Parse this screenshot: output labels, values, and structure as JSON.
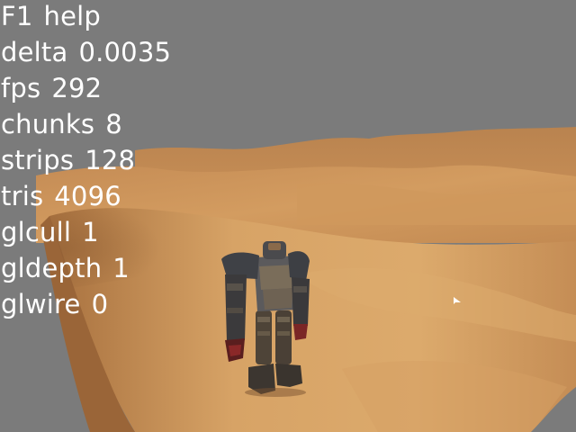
{
  "hud": {
    "lines": [
      {
        "key": "F1",
        "value": "help"
      },
      {
        "key": "delta",
        "value": "0.0035"
      },
      {
        "key": "fps",
        "value": "292"
      },
      {
        "key": "chunks",
        "value": "8"
      },
      {
        "key": "strips",
        "value": "128"
      },
      {
        "key": "tris",
        "value": "4096"
      },
      {
        "key": "glcull",
        "value": "1"
      },
      {
        "key": "gldepth",
        "value": "1"
      },
      {
        "key": "glwire",
        "value": "0"
      }
    ]
  },
  "scene": {
    "sky_color": "#7b7b7b",
    "sand_light": "#d8a466",
    "sand_mid": "#c08650",
    "sand_shadow": "#9e6a3c",
    "character": "armored-robot-model"
  }
}
